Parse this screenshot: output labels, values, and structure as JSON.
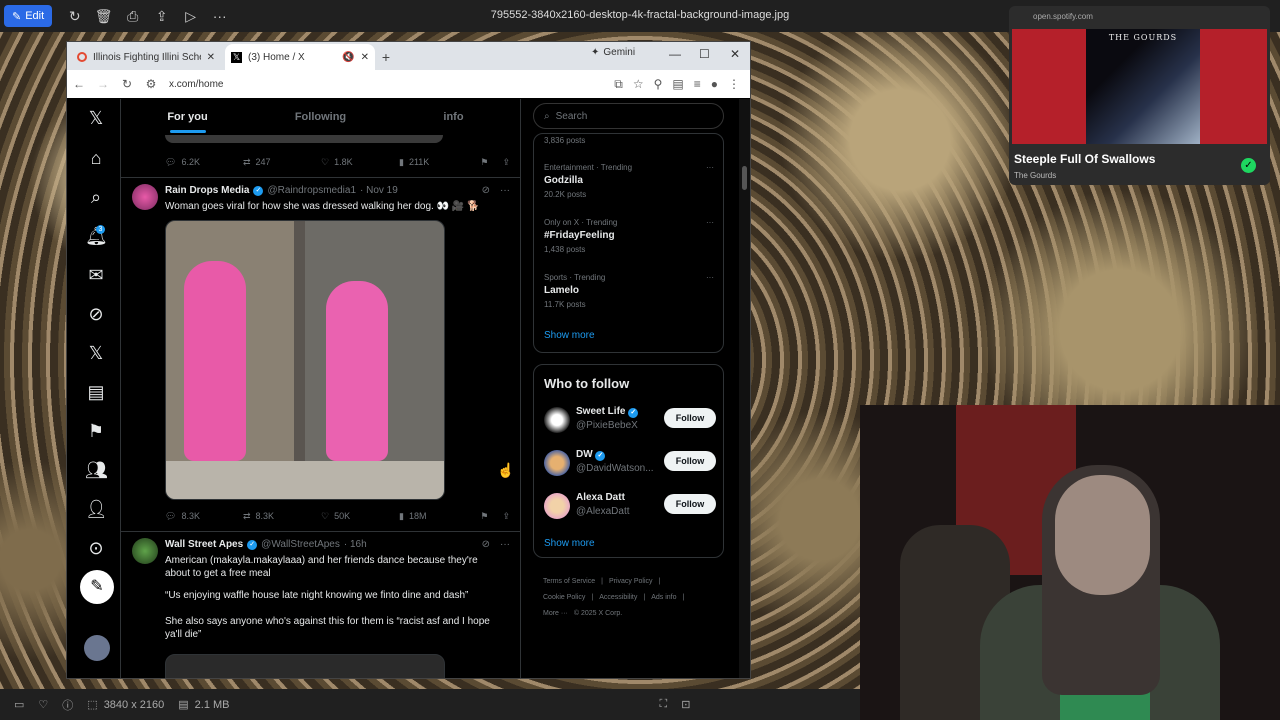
{
  "viewer": {
    "edit_label": "Edit",
    "filename": "795552-3840x2160-desktop-4k-fractal-background-image.jpg",
    "dimensions": "3840 x 2160",
    "filesize": "2.1 MB"
  },
  "browser": {
    "tabs": [
      {
        "label": "Illinois Fighting Illini Schedule |"
      },
      {
        "label": "(3) Home / X"
      }
    ],
    "gemini_label": "Gemini",
    "url": "x.com/home"
  },
  "x": {
    "nav_badge": "3",
    "timeline_tabs": [
      "For you",
      "Following",
      "info"
    ],
    "top_actions": {
      "replies": "6.2K",
      "reposts": "247",
      "likes": "1.8K",
      "views": "211K"
    },
    "tweet1": {
      "name": "Rain Drops Media",
      "handle": "@Raindropsmedia1",
      "time": "· Nov 19",
      "text": "Woman goes viral for how she was dressed walking her dog. 👀 🎥 🐕",
      "actions": {
        "replies": "8.3K",
        "reposts": "8.3K",
        "likes": "50K",
        "views": "18M"
      }
    },
    "tweet2": {
      "name": "Wall Street Apes",
      "handle": "@WallStreetApes",
      "time": "· 16h",
      "text1": "American (makayla.makaylaaa) and her friends dance because they're about to get a free meal",
      "text2": "“Us enjoying waffle house late night knowing we finto dine and dash”",
      "text3": "She also says anyone who's against this for them is “racist asf and I hope ya'll die”"
    },
    "search_placeholder": "Search",
    "trends_top_posts": "3,836 posts",
    "trends": [
      {
        "context": "Entertainment · Trending",
        "title": "Godzilla",
        "posts": "20.2K posts"
      },
      {
        "context": "Only on X · Trending",
        "title": "#FridayFeeling",
        "posts": "1,438 posts"
      },
      {
        "context": "Sports · Trending",
        "title": "Lamelo",
        "posts": "11.7K posts"
      }
    ],
    "show_more": "Show more",
    "who_to_follow_title": "Who to follow",
    "who_to_follow": [
      {
        "name": "Sweet Life",
        "handle": "@PixieBebeX",
        "verified": true,
        "button": "Follow"
      },
      {
        "name": "DW",
        "handle": "@DavidWatson...",
        "verified": true,
        "button": "Follow"
      },
      {
        "name": "Alexa Datt",
        "handle": "@AlexaDatt",
        "verified": false,
        "button": "Follow"
      }
    ],
    "footer": [
      "Terms of Service",
      "|",
      "Privacy Policy",
      "|",
      "Cookie Policy",
      "|",
      "Accessibility",
      "|",
      "Ads info",
      "|",
      "More ···",
      "© 2025 X Corp."
    ]
  },
  "spotify": {
    "domain": "open.spotify.com",
    "cover_text": "THE GOURDS",
    "song": "Steeple Full Of Swallows",
    "artist": "The Gourds"
  },
  "colors": {
    "accent": "#1d9bf0",
    "spotify_green": "#1ed760",
    "edit_blue": "#2b6ae6"
  }
}
